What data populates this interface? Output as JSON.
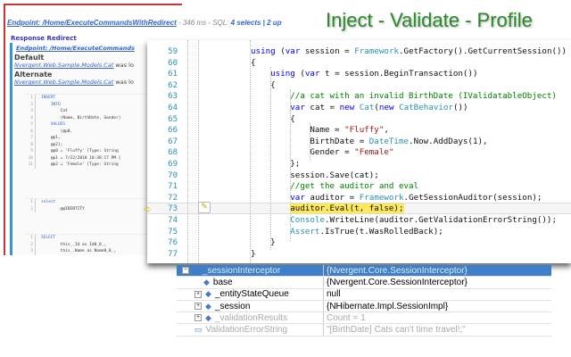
{
  "profiler": {
    "endpoint_link": "Endpoint: /Home/ExecuteCommandsWithRedirect",
    "timing": " - 346 ms - SQL: ",
    "sql_summary": "4 selects | 2 up",
    "response_redirect": "Response Redirect",
    "inner_endpoint": "Endpoint: /Home/ExecuteCommands",
    "default_heading": "Default",
    "default_link": "Nvergent.Web.Sample.Models.Cat",
    "default_suffix": " was lo",
    "alternate_heading": "Alternate",
    "alternate_link": "Nvergent.Web.Sample.Models.Cat",
    "alternate_suffix": " was lo",
    "sql_blocks": [
      [
        "INSERT",
        "    INTO",
        "        Cat",
        "        (Name, BirthDate, Gender)",
        "    VALUES",
        "        (@p0,",
        "    @p1,",
        "    @p2);",
        "    @p0 = 'Fluffy' [Type: String",
        "    @p1 = 7/22/2010 10:38:17 PM [",
        "    @p2 = 'Female' [Type: String"
      ],
      [
        "select",
        "        @@IDENTITY"
      ],
      [
        "SELECT",
        "        this_.Id as Id0_0_,",
        "        this_.Name as Name0_0_,"
      ]
    ]
  },
  "title": "Inject - Validate - Profile",
  "editor": {
    "line_numbers": [
      "59",
      "60",
      "61",
      "62",
      "63",
      "64",
      "65",
      "66",
      "67",
      "68",
      "69",
      "70",
      "71",
      "72",
      "73",
      "74",
      "75",
      "76",
      "77"
    ],
    "current_line": "73"
  },
  "watch": {
    "rows": [
      {
        "name": "_sessionInterceptor",
        "value": "{Nvergent.Core.SessionInterceptor}",
        "expander": "⊟"
      },
      {
        "name": "base",
        "value": "{Nvergent.Core.SessionInterceptor}",
        "expander": ""
      },
      {
        "name": "_entityStateQueue",
        "value": "null",
        "expander": "⊞"
      },
      {
        "name": "_session",
        "value": "{NHibernate.Impl.SessionImpl}",
        "expander": "⊞"
      },
      {
        "name": "_validationResults",
        "value": "Count = 1",
        "expander": "⊞"
      },
      {
        "name": "ValidationErrorString",
        "value": "\"[BirthDate] Cats can't time travel!;\"",
        "expander": ""
      }
    ]
  }
}
